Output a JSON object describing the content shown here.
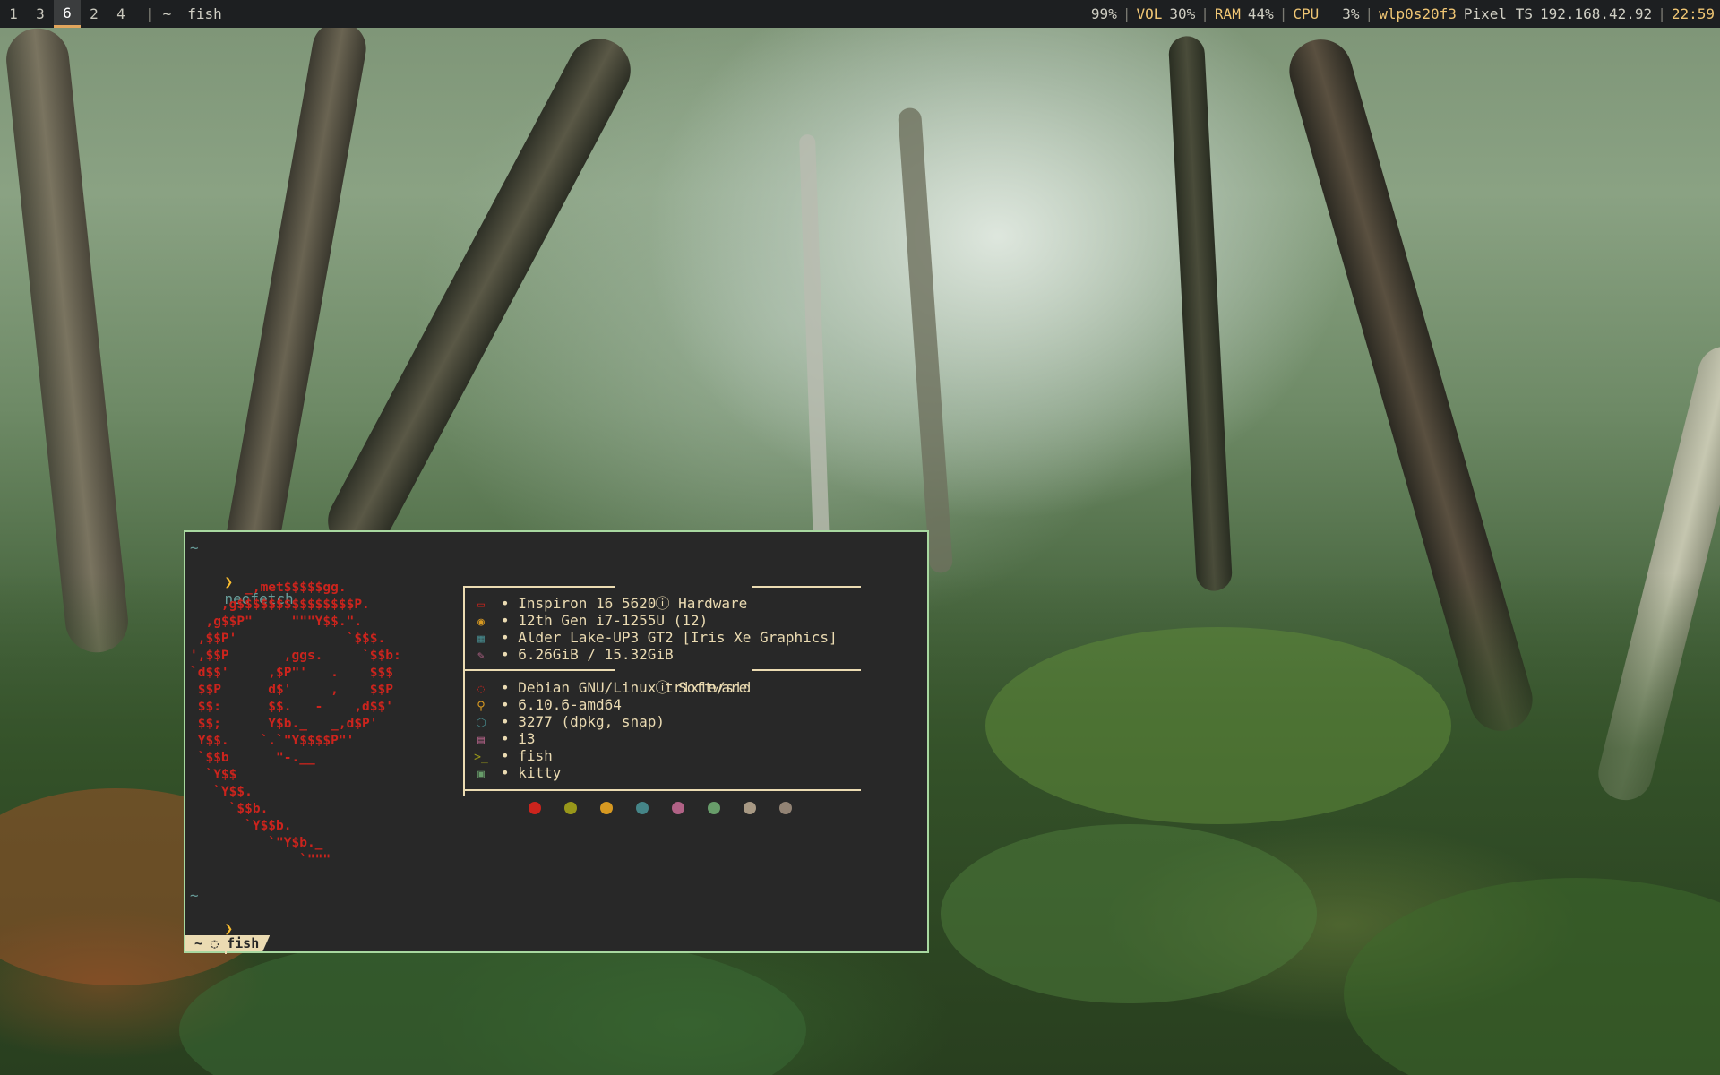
{
  "topbar": {
    "workspaces": [
      "1",
      "3",
      "6",
      "2",
      "4"
    ],
    "active_workspace": "6",
    "separator": "|",
    "window_path": "~",
    "window_title": "fish",
    "battery": "99%",
    "volume_label": "VOL",
    "volume_value": "30%",
    "ram_label": "RAM",
    "ram_value": "44%",
    "cpu_label": "CPU",
    "cpu_value": "3%",
    "network_interface": "wlp0s20f3",
    "network_ssid": "Pixel_TS",
    "network_ip": "192.168.42.92",
    "clock": "22:59"
  },
  "terminal": {
    "prev_dir": "~",
    "prompt_symbol": "❯",
    "command": "neofetch",
    "ascii_art": "       _,met$$$$$gg.\n    ,g$$$$$$$$$$$$$$$P.\n  ,g$$P\"     \"\"\"Y$$.\".\n ,$$P'              `$$$.\n',$$P       ,ggs.     `$$b:\n`d$$'     ,$P\"'   .    $$$\n $$P      d$'     ,    $$P\n $$:      $$.   -    ,d$$'\n $$;      Y$b._   _,d$P'\n Y$$.    `.`\"Y$$$$P\"'\n `$$b      \"-.__\n  `Y$$\n   `Y$$.\n     `$$b.\n       `Y$$b.\n          `\"Y$b._\n              `\"\"\"",
    "hardware_title": "Hardware",
    "software_title": "Software",
    "hardware": [
      {
        "icon": "laptop-icon",
        "glyph": "▭",
        "color": "#cc241d",
        "value": "Inspiron 16 5620"
      },
      {
        "icon": "cpu-icon",
        "glyph": "◉",
        "color": "#d79921",
        "value": "12th Gen i7-1255U (12)"
      },
      {
        "icon": "gpu-icon",
        "glyph": "▦",
        "color": "#458588",
        "value": "Alder Lake-UP3 GT2 [Iris Xe Graphics]"
      },
      {
        "icon": "memory-icon",
        "glyph": "✎",
        "color": "#b16286",
        "value": "6.26GiB / 15.32GiB"
      }
    ],
    "software": [
      {
        "icon": "debian-icon",
        "glyph": "◌",
        "color": "#cc241d",
        "value": "Debian GNU/Linux trixie/sid"
      },
      {
        "icon": "linux-icon",
        "glyph": "⚲",
        "color": "#d79921",
        "value": "6.10.6-amd64"
      },
      {
        "icon": "package-icon",
        "glyph": "⬡",
        "color": "#458588",
        "value": "3277 (dpkg, snap)"
      },
      {
        "icon": "window-manager-icon",
        "glyph": "▤",
        "color": "#b16286",
        "value": "i3"
      },
      {
        "icon": "shell-icon",
        "glyph": ">_",
        "color": "#98971a",
        "value": "fish"
      },
      {
        "icon": "terminal-icon",
        "glyph": "▣",
        "color": "#689d6a",
        "value": "kitty"
      }
    ],
    "bullet": "•",
    "palette": [
      "#cc241d",
      "#98971a",
      "#d79921",
      "#458588",
      "#b16286",
      "#689d6a",
      "#a89984",
      "#928374"
    ],
    "statusline_tab": "~ ◌ fish"
  }
}
